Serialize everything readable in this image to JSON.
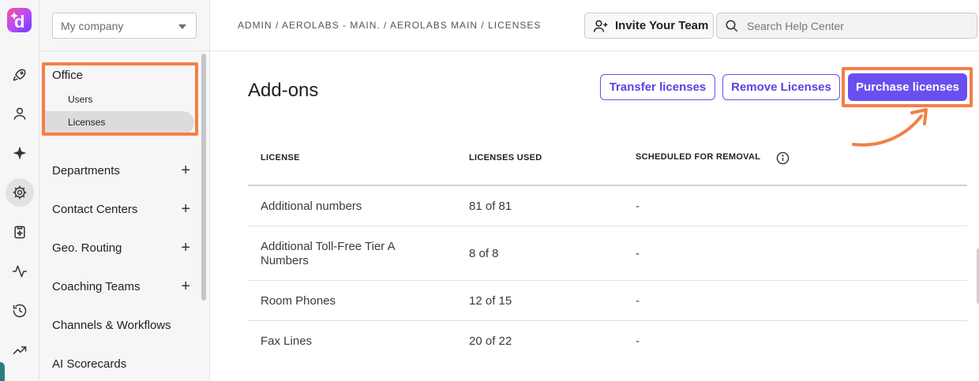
{
  "sidebar": {
    "company_select": "My company",
    "office": {
      "title": "Office",
      "items": [
        "Users",
        "Licenses"
      ]
    },
    "nav": [
      {
        "label": "Departments",
        "expandable": true
      },
      {
        "label": "Contact Centers",
        "expandable": true
      },
      {
        "label": "Geo. Routing",
        "expandable": true
      },
      {
        "label": "Coaching Teams",
        "expandable": true
      },
      {
        "label": "Channels & Workflows",
        "expandable": false
      },
      {
        "label": "AI Scorecards",
        "expandable": false
      }
    ],
    "plus_glyph": "+"
  },
  "header": {
    "breadcrumb": "ADMIN / AEROLABS - MAIN. / AEROLABS MAIN / LICENSES",
    "invite_label": "Invite Your Team",
    "search_placeholder": "Search Help Center"
  },
  "main": {
    "title": "Add-ons",
    "buttons": {
      "transfer": "Transfer licenses",
      "remove": "Remove Licenses",
      "purchase": "Purchase licenses"
    },
    "table": {
      "headers": [
        "LICENSE",
        "LICENSES USED",
        "SCHEDULED FOR REMOVAL"
      ],
      "rows": [
        {
          "license": "Additional numbers",
          "used": "81 of 81",
          "scheduled": "-"
        },
        {
          "license": "Additional Toll-Free Tier A Numbers",
          "used": "8 of 8",
          "scheduled": "-"
        },
        {
          "license": "Room Phones",
          "used": "12 of 15",
          "scheduled": "-"
        },
        {
          "license": "Fax Lines",
          "used": "20 of 22",
          "scheduled": "-"
        }
      ]
    }
  },
  "colors": {
    "accent": "#6a4ff0",
    "highlight": "#f47f46"
  },
  "icons": {
    "rail": [
      "rocket-icon",
      "person-icon",
      "sparkle-icon",
      "gear-icon",
      "clipboard-icon",
      "activity-icon",
      "history-icon",
      "trending-icon"
    ]
  }
}
